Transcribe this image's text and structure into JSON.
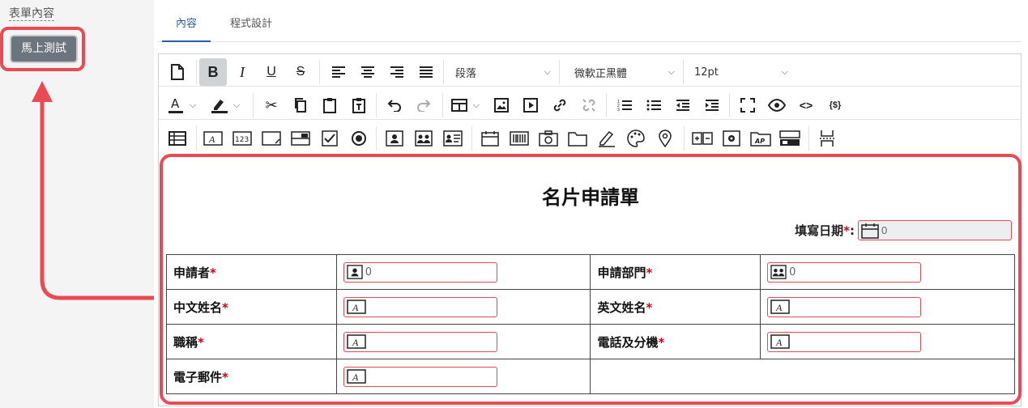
{
  "left_panel": {
    "title": "表單內容",
    "test_button": "馬上測試"
  },
  "tabs": [
    {
      "label": "內容",
      "active": true
    },
    {
      "label": "程式設計",
      "active": false
    }
  ],
  "toolbar": {
    "paragraph_select": "段落",
    "font_select": "微軟正黑體",
    "size_select": "12pt"
  },
  "form": {
    "title": "名片申請單",
    "date_label": "填寫日期",
    "date_value": "0",
    "required_mark": "*",
    "colon": ":",
    "rows": [
      {
        "label1": "申請者",
        "value1": "0",
        "icon1": "contact-card-icon",
        "label2": "申請部門",
        "value2": "0",
        "icon2": "group-card-icon"
      },
      {
        "label1": "中文姓名",
        "value1": "",
        "icon1": "text-field-icon",
        "label2": "英文姓名",
        "value2": "",
        "icon2": "text-field-icon"
      },
      {
        "label1": "職稱",
        "value1": "",
        "icon1": "text-field-icon",
        "label2": "電話及分機",
        "value2": "",
        "icon2": "text-field-icon"
      },
      {
        "label1": "電子郵件",
        "value1": "",
        "icon1": "text-field-icon"
      }
    ]
  },
  "colors": {
    "highlight": "#ea4a54",
    "active_tab": "#2c5ea8",
    "button": "#6c757d",
    "required": "#d0021b"
  }
}
